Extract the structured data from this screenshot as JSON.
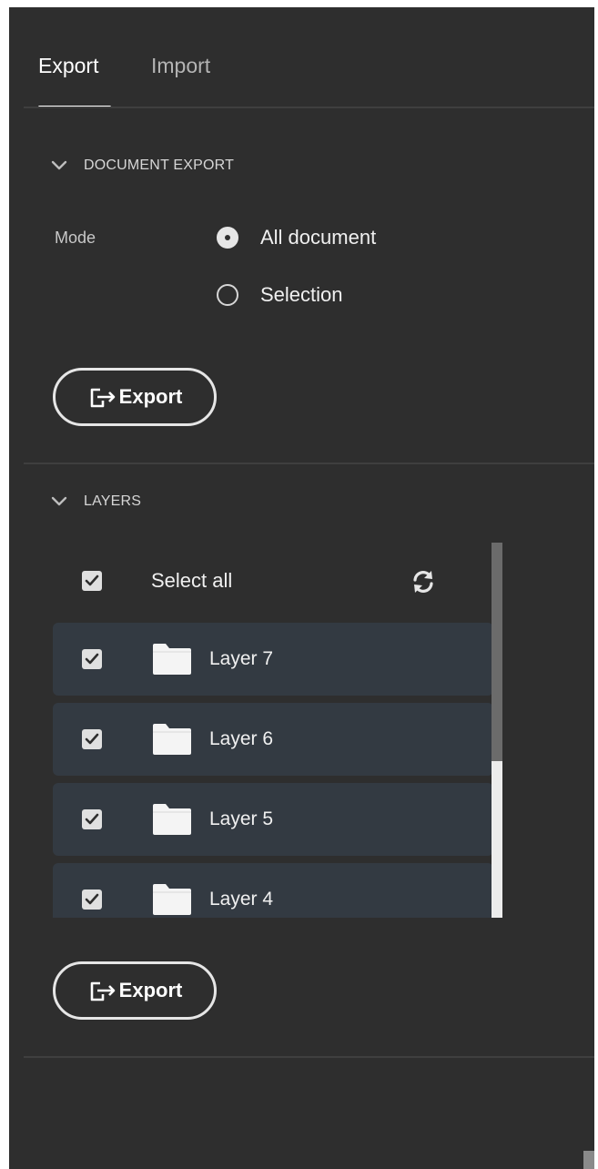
{
  "tabs": [
    {
      "label": "Export",
      "active": true
    },
    {
      "label": "Import",
      "active": false
    }
  ],
  "document_export": {
    "title": "DOCUMENT EXPORT",
    "mode_label": "Mode",
    "options": [
      {
        "label": "All document",
        "selected": true
      },
      {
        "label": "Selection",
        "selected": false
      }
    ],
    "export_label": "Export"
  },
  "layers": {
    "title": "LAYERS",
    "select_all_label": "Select all",
    "select_all_checked": true,
    "items": [
      {
        "label": "Layer 7",
        "checked": true
      },
      {
        "label": "Layer 6",
        "checked": true
      },
      {
        "label": "Layer 5",
        "checked": true
      },
      {
        "label": "Layer 4",
        "checked": true
      }
    ],
    "export_label": "Export"
  },
  "colors": {
    "panel_bg": "#2e2e2e",
    "row_bg": "#333a42",
    "text": "#f0f0f0",
    "accent": "#ffffff"
  },
  "icons": {
    "chevron": "chevron-down-icon",
    "export": "export-arrow-icon",
    "refresh": "refresh-icon",
    "folder": "folder-icon",
    "check": "checkmark-icon"
  }
}
